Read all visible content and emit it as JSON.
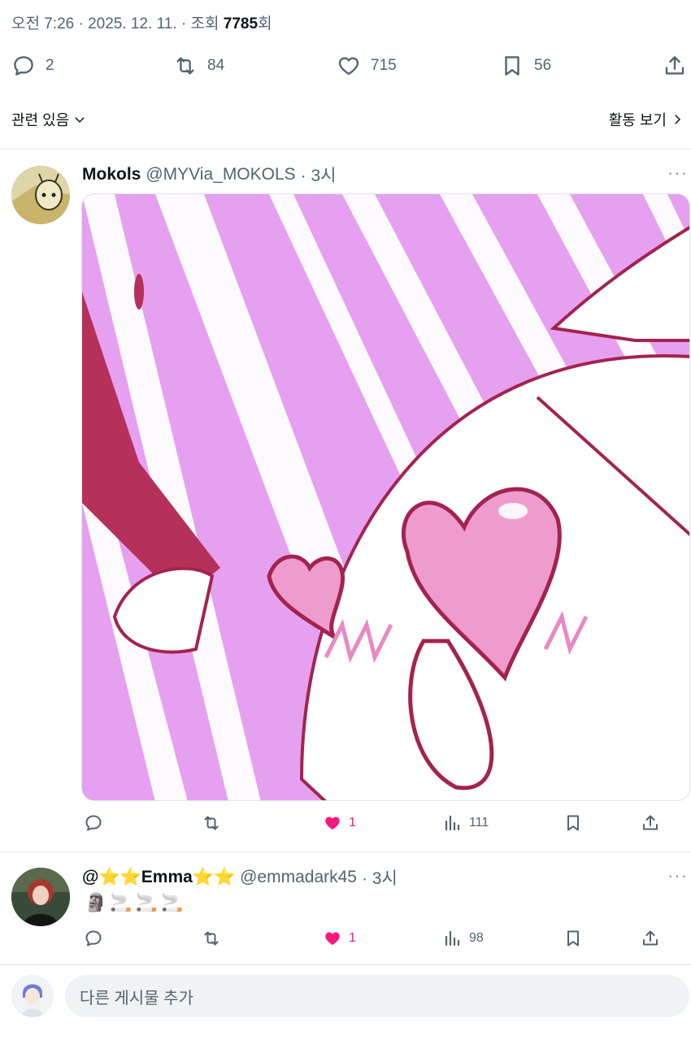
{
  "post_meta": {
    "time": "오전 7:26",
    "sep1": " · ",
    "date": "2025. 12. 11.",
    "sep2": " · ",
    "views_label": "조회 ",
    "views_value": "7785",
    "views_suffix": "회"
  },
  "post_actions": {
    "replies": "2",
    "reposts": "84",
    "likes": "715",
    "bookmarks": "56"
  },
  "related": {
    "label": "관련 있음"
  },
  "activity": {
    "label": "활동 보기"
  },
  "reply1": {
    "name": "Mokols",
    "handle": "@MYVia_MOKOLS",
    "time": "· 3시",
    "likes": "1",
    "views": "111"
  },
  "reply2": {
    "name": "@⭐⭐Emma⭐⭐",
    "handle": "@emmadark45",
    "time": "· 3시",
    "text_emojis": [
      "🗿",
      "🚬",
      "🚬",
      "🚬"
    ],
    "likes": "1",
    "views": "98"
  },
  "composer": {
    "placeholder": "다른 게시물 추가"
  },
  "colors": {
    "accent_like": "#f91880",
    "text_secondary": "#536471",
    "media_pink": "#e9a4f2",
    "media_crimson": "#b5305a"
  }
}
